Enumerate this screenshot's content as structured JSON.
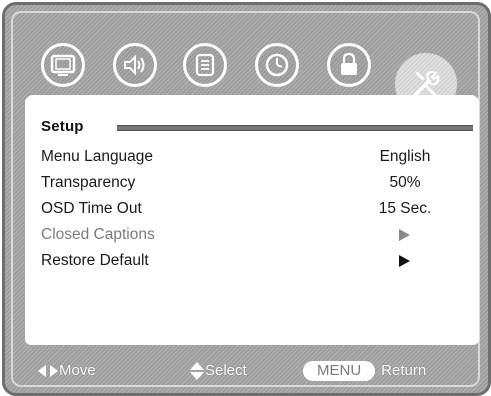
{
  "tabs": [
    {
      "icon": "display-icon",
      "active": false
    },
    {
      "icon": "speaker-icon",
      "active": false
    },
    {
      "icon": "document-icon",
      "active": false
    },
    {
      "icon": "clock-icon",
      "active": false
    },
    {
      "icon": "lock-icon",
      "active": false
    },
    {
      "icon": "wrench-screwdriver-icon",
      "active": true
    }
  ],
  "panel": {
    "title": "Setup",
    "items": [
      {
        "label": "Menu Language",
        "value": "English"
      },
      {
        "label": "Transparency",
        "value": "50%"
      },
      {
        "label": "OSD Time Out",
        "value": "15 Sec."
      },
      {
        "label": "Closed Captions",
        "value": "",
        "submenu": true,
        "disabled": true
      },
      {
        "label": "Restore Default",
        "value": "",
        "submenu": true,
        "disabled": false
      }
    ]
  },
  "footer": {
    "move_label": "Move",
    "select_label": "Select",
    "menu_key": "MENU",
    "return_label": "Return"
  }
}
